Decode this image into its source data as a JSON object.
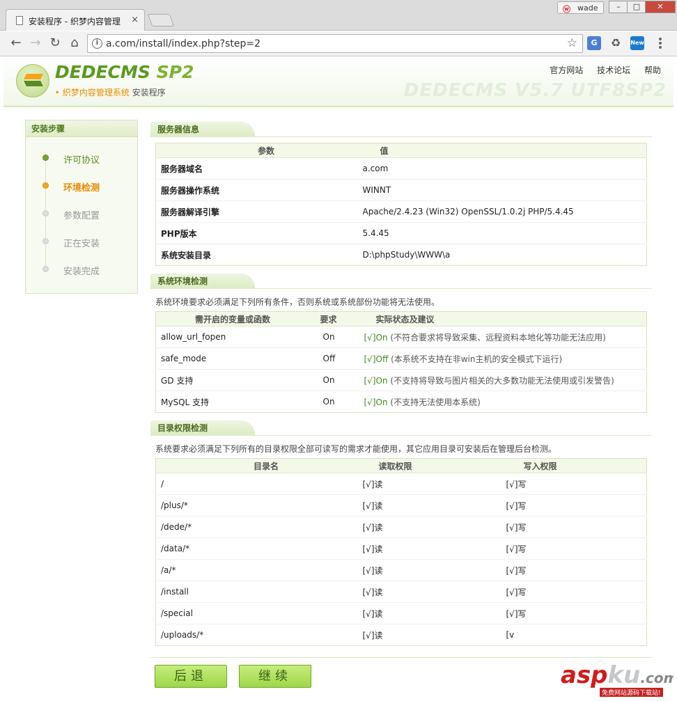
{
  "browser": {
    "tab_title": "安装程序 - 织梦内容管理",
    "tab_close": "×",
    "user_name": "wade",
    "url": "a.com/install/index.php?step=2",
    "win_min": "–",
    "win_max": "□",
    "win_close": "✕"
  },
  "header": {
    "logo_main": "DEDECMS",
    "logo_sp": "SP2",
    "logo_sub_accent": "织梦内容管理系统",
    "logo_sub_rest": "安装程序",
    "links": [
      "官方网站",
      "技术论坛",
      "帮助"
    ],
    "version_watermark": "DEDECMS V5.7 UTF8SP2"
  },
  "sidebar": {
    "title": "安装步骤",
    "steps": [
      {
        "label": "许可协议",
        "state": "done"
      },
      {
        "label": "环境检测",
        "state": "active"
      },
      {
        "label": "参数配置",
        "state": "todo"
      },
      {
        "label": "正在安装",
        "state": "todo"
      },
      {
        "label": "安装完成",
        "state": "todo"
      }
    ]
  },
  "server_info": {
    "title": "服务器信息",
    "headers": [
      "参数",
      "值"
    ],
    "rows": [
      {
        "param": "服务器域名",
        "value": "a.com"
      },
      {
        "param": "服务器操作系统",
        "value": "WINNT"
      },
      {
        "param": "服务器解译引擎",
        "value": "Apache/2.4.23 (Win32) OpenSSL/1.0.2j PHP/5.4.45"
      },
      {
        "param": "PHP版本",
        "value": "5.4.45"
      },
      {
        "param": "系统安装目录",
        "value": "D:\\phpStudy\\WWW\\a"
      }
    ]
  },
  "env_check": {
    "title": "系统环境检测",
    "note": "系统环境要求必须满足下列所有条件，否则系统或系统部份功能将无法使用。",
    "headers": [
      "需开启的变量或函数",
      "要求",
      "实际状态及建议"
    ],
    "rows": [
      {
        "name": "allow_url_fopen",
        "req": "On",
        "status": "[√]On",
        "advice": "(不符合要求将导致采集、远程资料本地化等功能无法应用)"
      },
      {
        "name": "safe_mode",
        "req": "Off",
        "status": "[√]Off",
        "advice": "(本系统不支持在非win主机的安全模式下运行)"
      },
      {
        "name": "GD 支持",
        "req": "On",
        "status": "[√]On",
        "advice": "(不支持将导致与图片相关的大多数功能无法使用或引发警告)"
      },
      {
        "name": "MySQL 支持",
        "req": "On",
        "status": "[√]On",
        "advice": "(不支持无法使用本系统)"
      }
    ]
  },
  "dir_check": {
    "title": "目录权限检测",
    "note": "系统要求必须满足下列所有的目录权限全部可读写的需求才能使用，其它应用目录可安装后在管理后台检测。",
    "headers": [
      "目录名",
      "读取权限",
      "写入权限"
    ],
    "rows": [
      {
        "dir": "/",
        "read": "[√]读",
        "write": "[√]写"
      },
      {
        "dir": "/plus/*",
        "read": "[√]读",
        "write": "[√]写"
      },
      {
        "dir": "/dede/*",
        "read": "[√]读",
        "write": "[√]写"
      },
      {
        "dir": "/data/*",
        "read": "[√]读",
        "write": "[√]写"
      },
      {
        "dir": "/a/*",
        "read": "[√]读",
        "write": "[√]写"
      },
      {
        "dir": "/install",
        "read": "[√]读",
        "write": "[√]写"
      },
      {
        "dir": "/special",
        "read": "[√]读",
        "write": "[√]写"
      },
      {
        "dir": "/uploads/*",
        "read": "[√]读",
        "write": "[v"
      }
    ]
  },
  "buttons": {
    "back": "后退",
    "next": "继续"
  },
  "site_watermark": {
    "brand_a": "asp",
    "brand_b": "ku",
    "brand_c": ".com",
    "caption": "免费网站源码下载站!"
  },
  "colors": {
    "accent_green": "#5b9a1e",
    "active_orange": "#e88b00",
    "ok_green": "#3c8a1a",
    "button_green": "#9fd64a"
  }
}
